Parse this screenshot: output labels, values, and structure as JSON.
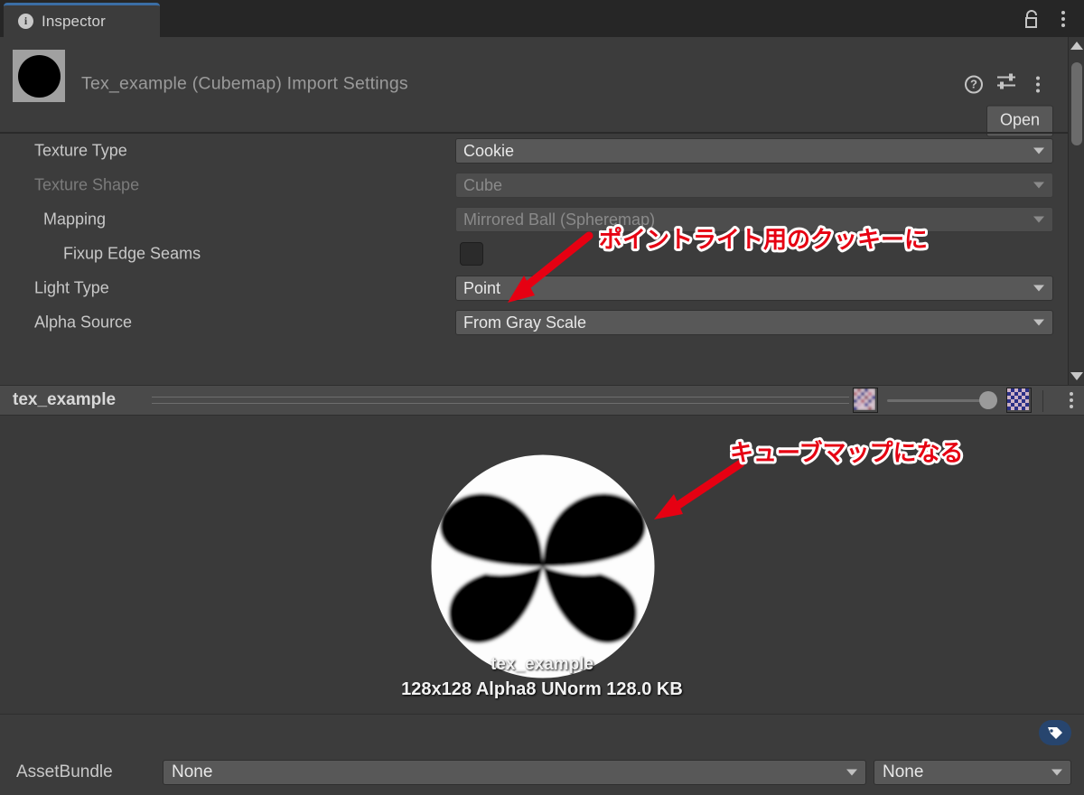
{
  "window": {
    "tab_label": "Inspector",
    "tab_icon": "info-icon",
    "lock_icon": "unlock-icon",
    "menu_icon": "kebab-menu-icon"
  },
  "header": {
    "asset_title": "Tex_example (Cubemap) Import Settings",
    "thumbnail_icon": "texture-thumbnail",
    "help_icon": "help-icon",
    "preset_icon": "preset-settings-icon",
    "menu_icon": "kebab-menu-icon",
    "open_label": "Open"
  },
  "properties": [
    {
      "label": "Texture Type",
      "value": "Cookie",
      "type": "dropdown",
      "disabled": false,
      "indent": 0
    },
    {
      "label": "Texture Shape",
      "value": "Cube",
      "type": "dropdown",
      "disabled": true,
      "indent": 0
    },
    {
      "label": "Mapping",
      "value": "Mirrored Ball (Spheremap)",
      "type": "dropdown",
      "disabled": true,
      "indent": 1
    },
    {
      "label": "Fixup Edge Seams",
      "value": "",
      "type": "checkbox",
      "checked": false,
      "indent": 2
    },
    {
      "label": "Light Type",
      "value": "Point",
      "type": "dropdown",
      "disabled": false,
      "indent": 0
    },
    {
      "label": "Alpha Source",
      "value": "From Gray Scale",
      "type": "dropdown",
      "disabled": false,
      "indent": 0
    }
  ],
  "preview_header": {
    "name": "tex_example",
    "mip_low_icon": "checkerboard-blurry-icon",
    "mip_high_icon": "checkerboard-sharp-icon",
    "slider_value": "100",
    "menu_icon": "kebab-menu-icon"
  },
  "preview": {
    "texture_name": "tex_example",
    "texture_info": "128x128  Alpha8 UNorm  128.0 KB"
  },
  "bottom": {
    "tag_icon": "tag-badge-icon",
    "assetbundle_label": "AssetBundle",
    "assetbundle_name": "None",
    "assetbundle_variant": "None"
  },
  "annotations": [
    {
      "text": "ポイントライト用のクッキーに",
      "pointer": "arrow-down-left"
    },
    {
      "text": "キューブマップになる",
      "pointer": "arrow-down-left"
    }
  ],
  "colors": {
    "accent_blue": "#3b6ea5",
    "panel_bg": "#3c3c3c",
    "field_bg": "#585858",
    "annotation_red": "#e60012",
    "tag_badge_blue": "#27456e"
  }
}
